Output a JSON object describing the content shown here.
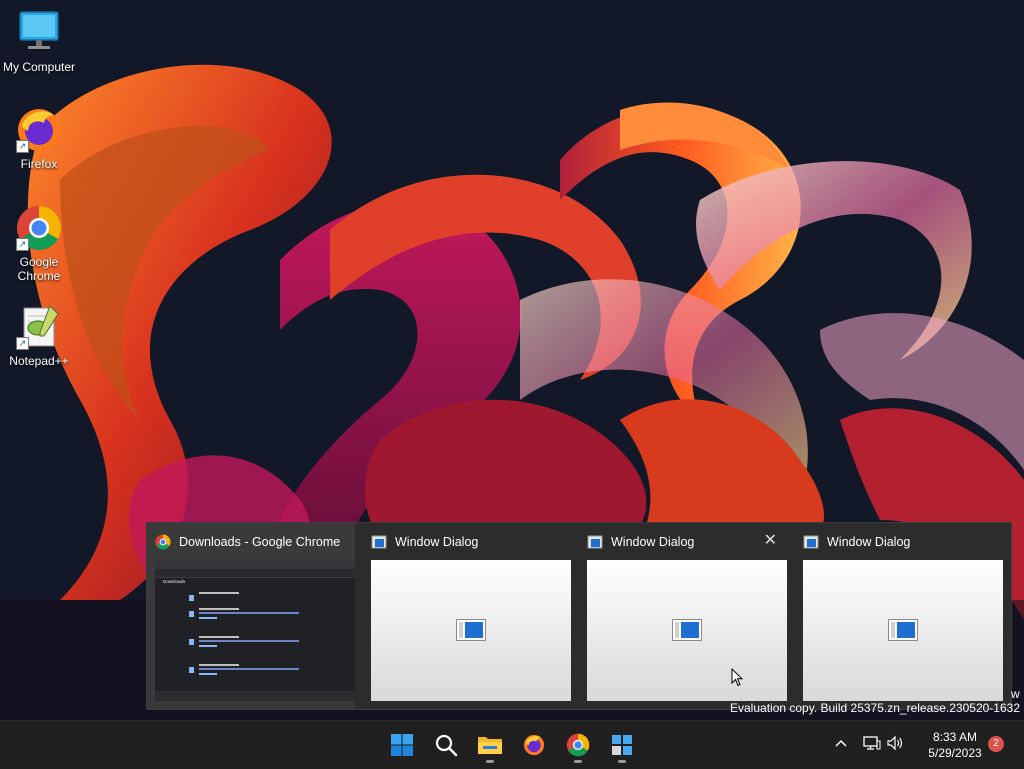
{
  "desktop": {
    "icons": [
      {
        "label": "My Computer",
        "icon": "computer-icon"
      },
      {
        "label": "Firefox",
        "icon": "firefox-icon"
      },
      {
        "label": "Google Chrome",
        "icon": "chrome-icon"
      },
      {
        "label": "Notepad++",
        "icon": "notepadpp-icon"
      }
    ]
  },
  "task_switcher": {
    "windows": [
      {
        "title": "Downloads - Google Chrome",
        "icon": "chrome-icon",
        "preview": {
          "page_title": "Downloads"
        }
      },
      {
        "title": "Window Dialog",
        "icon": "window-dialog-icon"
      },
      {
        "title": "Window Dialog",
        "icon": "window-dialog-icon",
        "close_glyph": "✕"
      },
      {
        "title": "Window Dialog",
        "icon": "window-dialog-icon"
      }
    ]
  },
  "watermark": {
    "line_partial": "w",
    "line": "Evaluation copy. Build 25375.zn_release.230520-1632"
  },
  "taskbar": {
    "pinned": [
      "start-icon",
      "search-icon",
      "file-explorer-icon",
      "firefox-icon",
      "chrome-icon",
      "window-dialog-icon"
    ],
    "tray": {
      "time": "8:33 AM",
      "date": "5/29/2023",
      "notification_count": "2"
    }
  },
  "colors": {
    "taskbar": "#202020",
    "switcher": "#2c2c2c",
    "badge": "#e0504c",
    "accent": "#0078d4"
  }
}
